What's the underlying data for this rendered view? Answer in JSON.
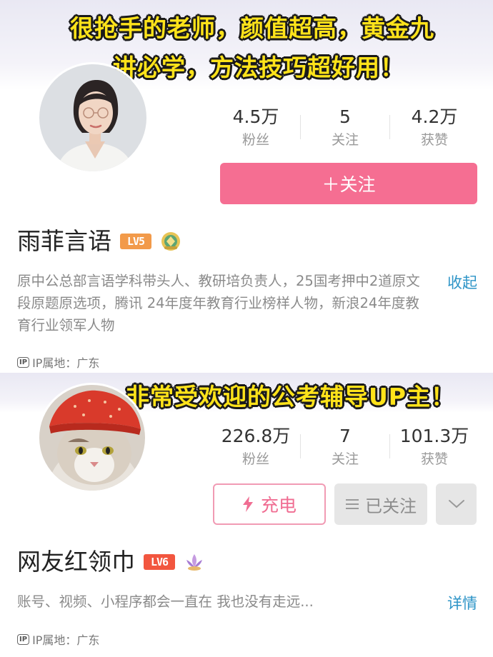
{
  "overlay": {
    "caption_top_line1": "很抢手的老师，颜值超高，黄金九",
    "caption_top_line2": "讲必学，方法技巧超好用！",
    "caption_middle": "非常受欢迎的公考辅导UP主！"
  },
  "profile1": {
    "avatar_icon": "woman-portrait-avatar",
    "stats": [
      {
        "value": "4.5万",
        "label": "粉丝"
      },
      {
        "value": "5",
        "label": "关注"
      },
      {
        "value": "4.2万",
        "label": "获赞"
      }
    ],
    "follow_label": "＋关注",
    "name": "雨菲言语",
    "level": "LV5",
    "level_color": "#f29a4a",
    "bio": "原中公总部言语学科带头人、教研培负责人，25国考押中2道原文段原题原选项，腾讯 24年度年教育行业榜样人物，新浪24年度教育行业领军人物",
    "bio_toggle": "收起",
    "ip_tag": "IP",
    "ip_text": "IP属地：广东"
  },
  "profile2": {
    "avatar_icon": "cat-with-red-headscarf-avatar",
    "stats": [
      {
        "value": "226.8万",
        "label": "粉丝"
      },
      {
        "value": "7",
        "label": "关注"
      },
      {
        "value": "101.3万",
        "label": "获赞"
      }
    ],
    "charge_label": "充电",
    "followed_label": "已关注",
    "name": "网友红领巾",
    "level": "LV6",
    "level_color": "#f2563f",
    "bio": "账号、视频、小程序都会一直在 我也没有走远...",
    "bio_toggle": "详情",
    "ip_tag": "IP",
    "ip_text": "IP属地：广东"
  },
  "colors": {
    "accent_pink": "#f56e92",
    "link_blue": "#2d94c7",
    "caption_yellow": "#ffe31a"
  }
}
